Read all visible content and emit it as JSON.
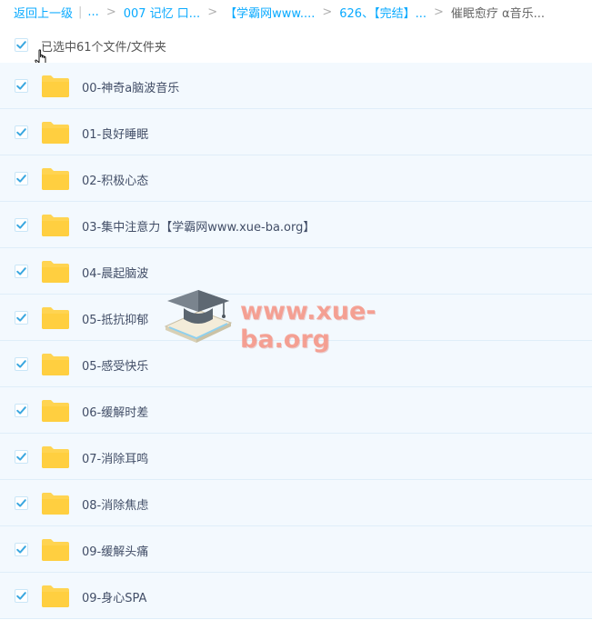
{
  "breadcrumb": {
    "back": "返回上一级",
    "ellipsis": "...",
    "items": [
      "007 记忆 口...",
      "【学霸网www....",
      "626、【完结】..."
    ],
    "current": "催眠愈疗 α音乐..."
  },
  "selection": {
    "count_text": "已选中61个文件/文件夹",
    "all_checked": true
  },
  "files": [
    {
      "name": "00-神奇a脑波音乐",
      "checked": true,
      "type": "folder"
    },
    {
      "name": "01-良好睡眠",
      "checked": true,
      "type": "folder"
    },
    {
      "name": "02-积极心态",
      "checked": true,
      "type": "folder"
    },
    {
      "name": "03-集中注意力【学霸网www.xue-ba.org】",
      "checked": true,
      "type": "folder"
    },
    {
      "name": "04-晨起脑波",
      "checked": true,
      "type": "folder"
    },
    {
      "name": "05-抵抗抑郁",
      "checked": true,
      "type": "folder"
    },
    {
      "name": "05-感受快乐",
      "checked": true,
      "type": "folder"
    },
    {
      "name": "06-缓解时差",
      "checked": true,
      "type": "folder"
    },
    {
      "name": "07-消除耳鸣",
      "checked": true,
      "type": "folder"
    },
    {
      "name": "08-消除焦虑",
      "checked": true,
      "type": "folder"
    },
    {
      "name": "09-缓解头痛",
      "checked": true,
      "type": "folder"
    },
    {
      "name": "09-身心SPA",
      "checked": true,
      "type": "folder"
    }
  ],
  "watermark": {
    "text": "www.xue-ba.org",
    "icon": "graduation-cap-book-icon"
  },
  "colors": {
    "link": "#09aaff",
    "check": "#3aa7e0",
    "folder": "#ffd451",
    "row_bg": "#f3f9fe",
    "watermark": "#f69687"
  }
}
